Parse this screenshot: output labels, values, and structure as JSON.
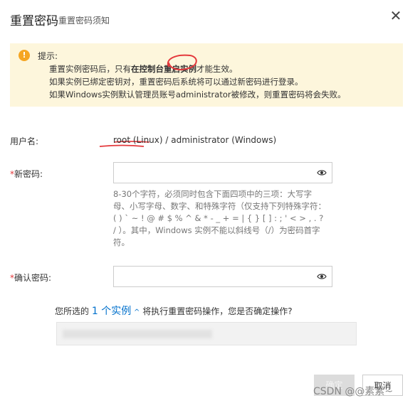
{
  "dialog": {
    "title": "重置密码",
    "subtitle": "重置密码须知",
    "close_icon": "close-icon"
  },
  "notice": {
    "title": "提示:",
    "line1_pre": "重置实例密码后，只有",
    "line1_bold": "在控制台重启实例",
    "line1_post": "才能生效。",
    "line2": "如果实例已绑定密钥对，重置密码后系统将可以通过新密码进行登录。",
    "line3": "如果Windows实例默认管理员账号administrator被修改，则重置密码将会失败。"
  },
  "form": {
    "username_label": "用户名:",
    "username_value": "root (Linux) / administrator (Windows)",
    "new_password_label": "新密码:",
    "new_password_value": "",
    "password_hint": "8-30个字符，必须同时包含下面四项中的三项：大写字母、小写字母、数字、和特殊字符（仅支持下列特殊字符：( ) ` ~ ! @ # $ % ^ & * - _ + = | { } [ ] : ; ' < > , . ? / ）。其中，Windows 实例不能以斜线号（/）为密码首字符。",
    "confirm_password_label": "确认密码:",
    "confirm_password_value": "",
    "required_mark": "*"
  },
  "confirm": {
    "pre": "您所选的",
    "count": "1 个实例",
    "post": "将执行重置密码操作，您是否确定操作?"
  },
  "buttons": {
    "ok": "确定",
    "cancel": "取消"
  },
  "watermark": "CSDN @@素素~",
  "colors": {
    "notice_bg": "#fdf6dc",
    "warning": "#f5a623",
    "link": "#0070cc",
    "required": "#e4393c"
  }
}
